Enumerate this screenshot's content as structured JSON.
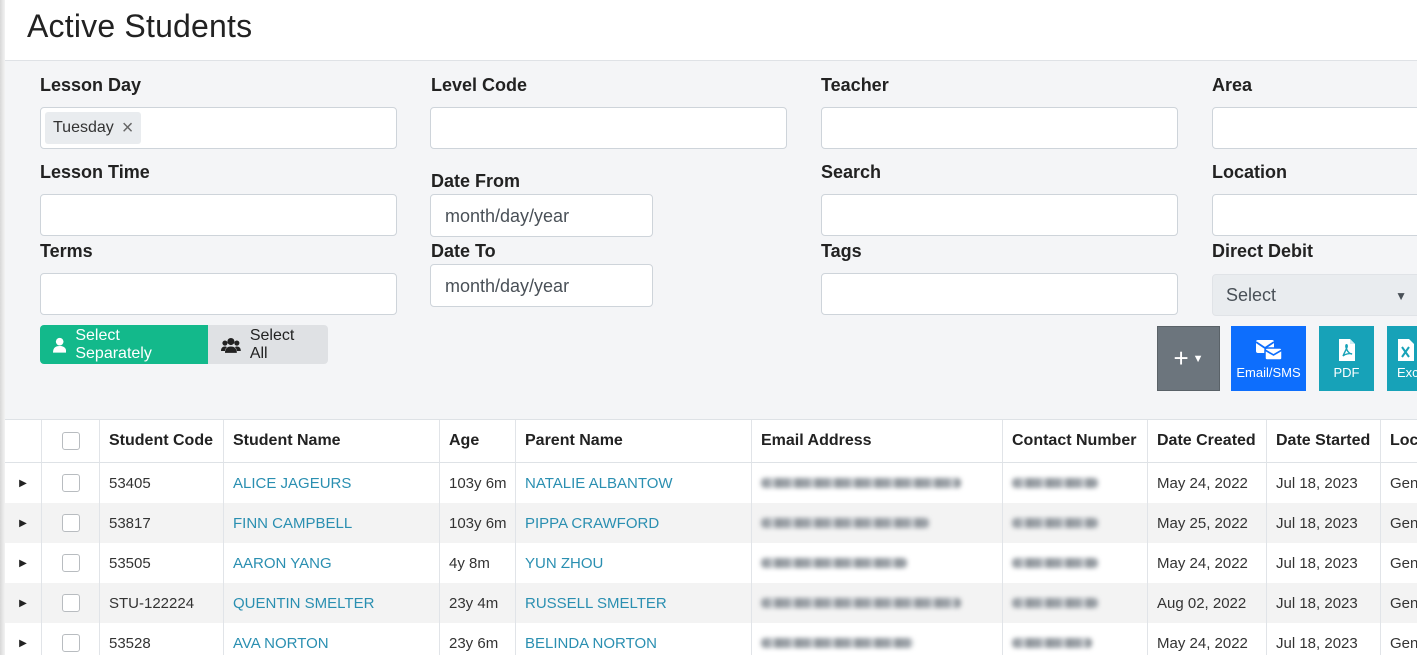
{
  "page": {
    "title": "Active Students"
  },
  "filters": {
    "lesson_day": {
      "label": "Lesson Day",
      "chips": [
        "Tuesday"
      ]
    },
    "level_code": {
      "label": "Level Code",
      "value": ""
    },
    "teacher": {
      "label": "Teacher",
      "value": ""
    },
    "area": {
      "label": "Area",
      "value": ""
    },
    "lesson_time": {
      "label": "Lesson Time",
      "value": ""
    },
    "date_from": {
      "label": "Date From",
      "placeholder": "month/day/year"
    },
    "search": {
      "label": "Search",
      "value": ""
    },
    "location": {
      "label": "Location",
      "value": ""
    },
    "terms": {
      "label": "Terms",
      "value": ""
    },
    "date_to": {
      "label": "Date To",
      "placeholder": "month/day/year"
    },
    "tags": {
      "label": "Tags",
      "value": ""
    },
    "direct_debit": {
      "label": "Direct Debit",
      "selected": "Select"
    }
  },
  "selection_toggle": {
    "separately": "Select Separately",
    "all": "Select All",
    "active": "separately"
  },
  "actions": {
    "add": "+",
    "email_sms": "Email/SMS",
    "pdf": "PDF",
    "excel": "Excel"
  },
  "table": {
    "columns": [
      "Student Code",
      "Student Name",
      "Age",
      "Parent Name",
      "Email Address",
      "Contact Number",
      "Date Created",
      "Date Started",
      "Location"
    ],
    "rows": [
      {
        "code": "53405",
        "name": "ALICE JAGEURS",
        "age": "103y 6m",
        "parent": "NATALIE ALBANTOW",
        "created": "May 24, 2022",
        "started": "Jul 18, 2023",
        "location": "General"
      },
      {
        "code": "53817",
        "name": "FINN CAMPBELL",
        "age": "103y 6m",
        "parent": "PIPPA CRAWFORD",
        "created": "May 25, 2022",
        "started": "Jul 18, 2023",
        "location": "General"
      },
      {
        "code": "53505",
        "name": "AARON YANG",
        "age": "4y 8m",
        "parent": "YUN ZHOU",
        "created": "May 24, 2022",
        "started": "Jul 18, 2023",
        "location": "General"
      },
      {
        "code": "STU-122224",
        "name": "QUENTIN SMELTER",
        "age": "23y 4m",
        "parent": "RUSSELL SMELTER",
        "created": "Aug 02, 2022",
        "started": "Jul 18, 2023",
        "location": "General"
      },
      {
        "code": "53528",
        "name": "AVA NORTON",
        "age": "23y 6m",
        "parent": "BELINDA NORTON",
        "created": "May 24, 2022",
        "started": "Jul 18, 2023",
        "location": "General"
      }
    ]
  }
}
